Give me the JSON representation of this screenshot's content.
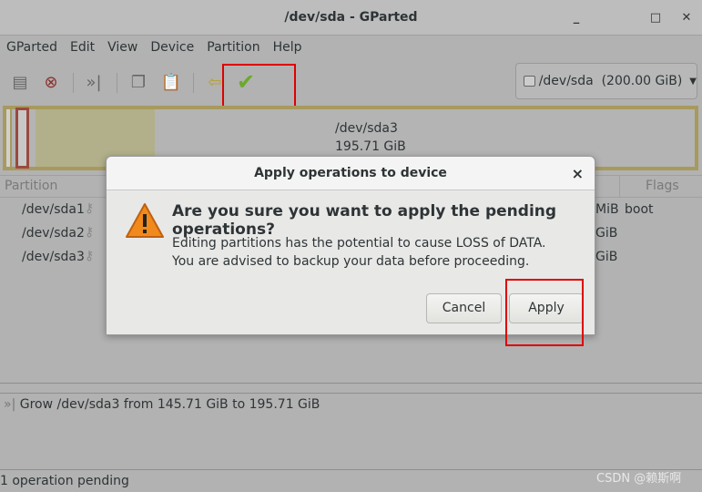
{
  "window": {
    "title": "/dev/sda - GParted",
    "minimize": "_",
    "maximize": "□",
    "close": "✕"
  },
  "menu": [
    "GParted",
    "Edit",
    "View",
    "Device",
    "Partition",
    "Help"
  ],
  "toolbar": {
    "icons": [
      "new-partition-icon",
      "delete-icon",
      "resize-move-icon",
      "copy-icon",
      "paste-icon",
      "undo-icon",
      "apply-icon"
    ]
  },
  "device_selector": {
    "label": "/dev/sda  (200.00 GiB)"
  },
  "disk_map": {
    "label": "/dev/sda3",
    "size": "195.71 GiB",
    "used_fill": 0.2
  },
  "table": {
    "headers": {
      "partition": "Partition",
      "flags": "Flags"
    },
    "rows": [
      {
        "name": "/dev/sda1",
        "size_tail": "MiB",
        "flags": "boot"
      },
      {
        "name": "/dev/sda2",
        "size_tail": "GiB",
        "flags": ""
      },
      {
        "name": "/dev/sda3",
        "size_tail": "GiB",
        "flags": ""
      }
    ]
  },
  "log": {
    "operation": "Grow /dev/sda3 from 145.71 GiB to 195.71 GiB"
  },
  "status": {
    "text": "1 operation pending"
  },
  "watermark": "CSDN @赖斯啊",
  "dialog": {
    "title": "Apply operations to device",
    "close": "×",
    "question": "Are you sure you want to apply the pending operations?",
    "message1": "Editing partitions has the potential to cause LOSS of DATA.",
    "message2": "You are advised to backup your data before proceeding.",
    "cancel": "Cancel",
    "apply": "Apply"
  },
  "colors": {
    "highlight": "#e00000",
    "apply_icon": "#6aaa2a",
    "warning": "#f08a1c"
  }
}
